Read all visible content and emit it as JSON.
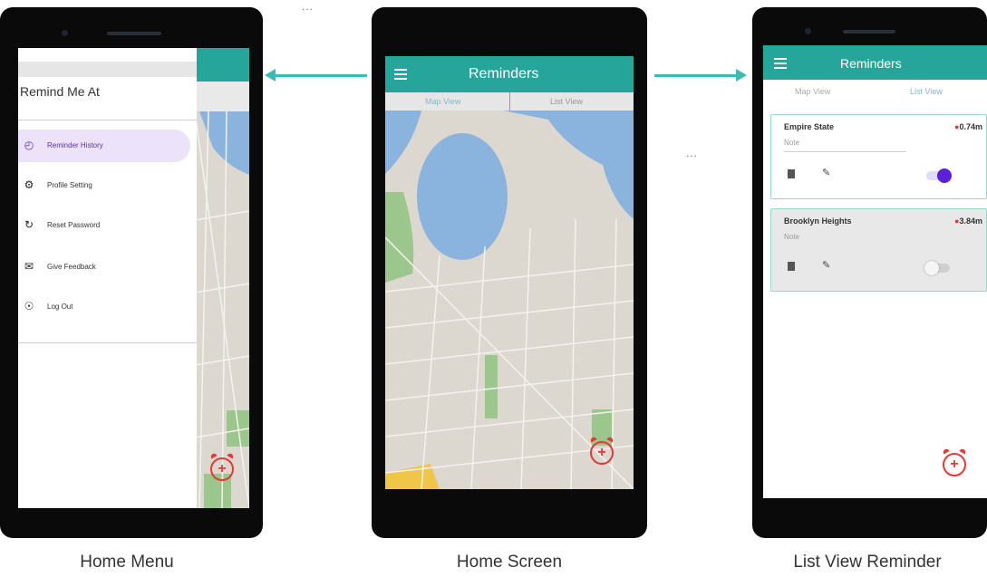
{
  "screens": {
    "home_menu": {
      "caption": "Home Menu",
      "drawer_title": "Remind Me At",
      "items": [
        {
          "label": "Reminder History",
          "icon": "history-icon"
        },
        {
          "label": "Profile Setting",
          "icon": "gear-icon"
        },
        {
          "label": "Reset Password",
          "icon": "reset-icon"
        },
        {
          "label": "Give Feedback",
          "icon": "feedback-icon"
        },
        {
          "label": "Log Out",
          "icon": "logout-icon"
        }
      ]
    },
    "home_screen": {
      "caption": "Home Screen",
      "title": "Reminders",
      "tab_map": "Map View",
      "tab_list": "List View"
    },
    "list_view": {
      "caption": "List View Reminder",
      "title": "Reminders",
      "tab_map": "Map View",
      "tab_list": "List View",
      "reminders": [
        {
          "name": "Empire State",
          "distance": "0.74m",
          "note": "Note",
          "enabled": true
        },
        {
          "name": "Brooklyn Heights",
          "distance": "3.84m",
          "note": "Note",
          "enabled": false
        }
      ]
    }
  },
  "separators": {
    "top": "...",
    "right": "..."
  },
  "colors": {
    "accent": "#26a69a",
    "alarm": "#e53935",
    "toggle_on": "#5b21d9",
    "active_bg": "#ece3fb"
  }
}
